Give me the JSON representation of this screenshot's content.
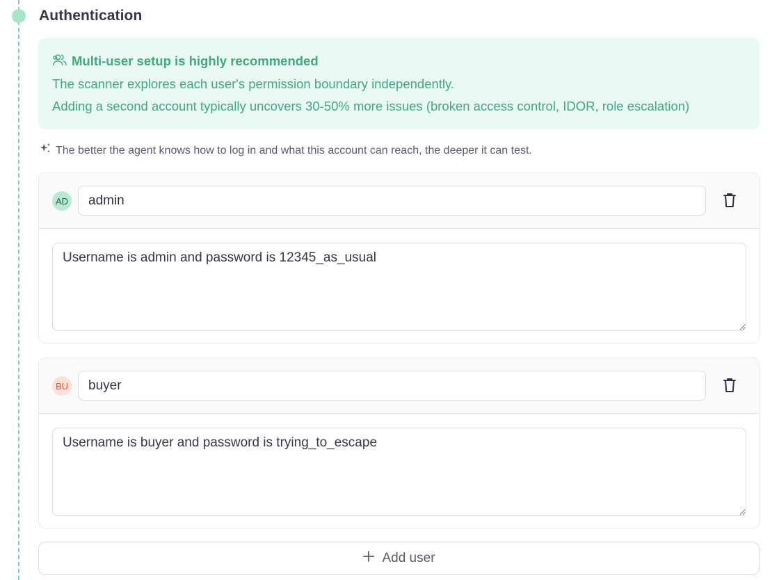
{
  "section": {
    "title": "Authentication"
  },
  "info": {
    "heading": "Multi-user setup is highly recommended",
    "line1": "The scanner explores each user's permission boundary independently.",
    "line2": "Adding a second account typically uncovers 30-50% more issues (broken access control, IDOR, role escalation)",
    "icon": "users-icon"
  },
  "hint": {
    "text": "The better the agent knows how to log in and what this account can reach, the deeper it can test.",
    "icon": "sparkles-icon"
  },
  "users": [
    {
      "initials": "AD",
      "name": "admin",
      "description": "Username is admin and password is 12345_as_usual",
      "avatar_bg": "#b5ead3",
      "avatar_color": "#2a5a48"
    },
    {
      "initials": "BU",
      "name": "buyer",
      "description": "Username is buyer and password is trying_to_escape",
      "avatar_bg": "#fde0d8",
      "avatar_color": "#d4583b"
    }
  ],
  "add_user_label": "Add user",
  "colors": {
    "accent": "#45a77c",
    "info_bg": "#e8faf3",
    "timeline": "#7fd3b2"
  }
}
